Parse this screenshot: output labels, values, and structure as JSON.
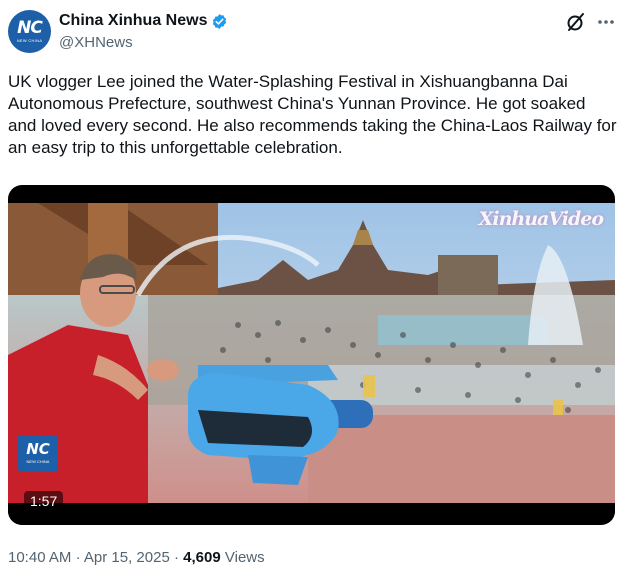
{
  "account": {
    "name": "China Xinhua News",
    "handle": "@XHNews",
    "avatar_logo": "NC",
    "avatar_sub": "NEW CHINA",
    "verified": true,
    "verified_color": "#1d9bf0"
  },
  "tweet": {
    "text": "UK vlogger Lee joined the Water-Splashing Festival in Xishuangbanna Dai Autonomous Prefecture, southwest China's Yunnan Province. He got soaked and loved every second. He also recommends taking the China-Laos Railway for an easy trip to this unforgettable celebration."
  },
  "media": {
    "watermark": "XinhuaVideo",
    "channel_logo": "NC",
    "channel_logo_sub": "NEW CHINA",
    "duration": "1:57"
  },
  "meta": {
    "time": "10:40 AM",
    "separator": "·",
    "date": "Apr 15, 2025",
    "views_count": "4,609",
    "views_label": "Views"
  },
  "icons": {
    "grok": "grok-icon",
    "more": "more-icon"
  },
  "colors": {
    "text": "#0f1419",
    "secondary": "#536471",
    "brand": "#1d5fa8"
  }
}
